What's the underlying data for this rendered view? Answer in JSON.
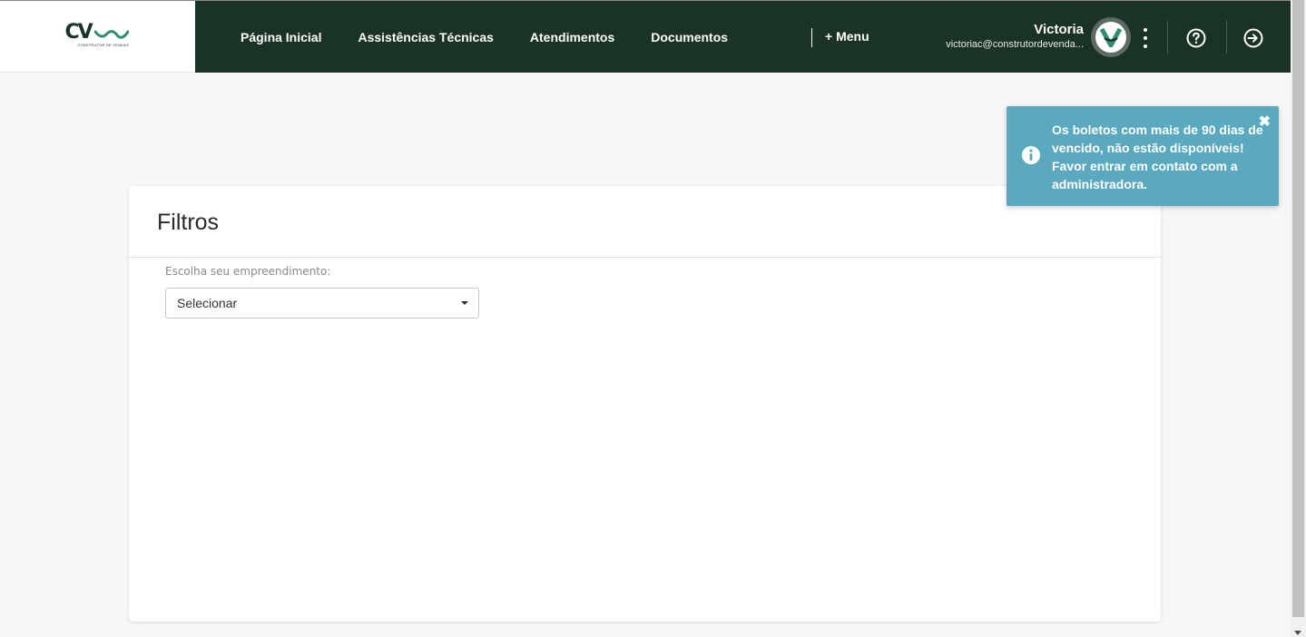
{
  "brand": {
    "logo_text": "CV",
    "logo_tagline": "CONSTRUTOR DE VENDAS",
    "logo_color": "#1b3326"
  },
  "header": {
    "background": "#1b3326",
    "nav_items": [
      "Página Inicial",
      "Assistências Técnicas",
      "Atendimentos",
      "Documentos"
    ],
    "menu_label": "+ Menu",
    "user_name": "Victoria",
    "user_email": "victoriac@construtordevenda...",
    "icons": [
      "avatar-logo",
      "kebab-icon",
      "help-icon",
      "logout-icon"
    ]
  },
  "filters": {
    "title": "Filtros",
    "field_label": "Escolha seu empreendimento:",
    "select_value": "Selecionar"
  },
  "toast": {
    "message": "Os boletos com mais de 90 dias de vencido, não estão disponíveis! Favor entrar em contato com a administradora.",
    "background": "#5aa9be",
    "icon": "info-icon",
    "close_symbol": "✖"
  }
}
